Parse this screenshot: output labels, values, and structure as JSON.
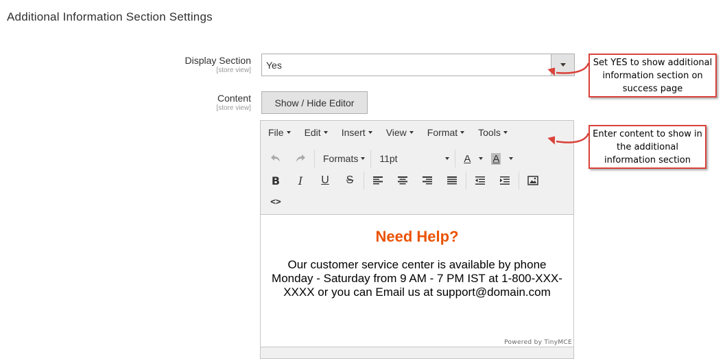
{
  "section_title": "Additional Information Section Settings",
  "display_section": {
    "label": "Display Section",
    "scope": "[store view]",
    "value": "Yes"
  },
  "content": {
    "label": "Content",
    "scope": "[store view]",
    "toggle_button": "Show / Hide Editor"
  },
  "editor": {
    "menu": [
      "File",
      "Edit",
      "Insert",
      "View",
      "Format",
      "Tools"
    ],
    "formats_label": "Formats",
    "font_size": "11pt",
    "body_title": "Need Help?",
    "body_text": "Our customer service center is available by phone Monday - Saturday from 9 AM - 7 PM IST at 1-800-XXX-XXXX or you can Email us at support@domain.com",
    "powered_by": "Powered by TinyMCE"
  },
  "callouts": {
    "display": "Set YES to show additional information section on success page",
    "content": "Enter content to show in the additional information section"
  },
  "colors": {
    "accent": "#eb5202",
    "callout_border": "#d9423a"
  }
}
